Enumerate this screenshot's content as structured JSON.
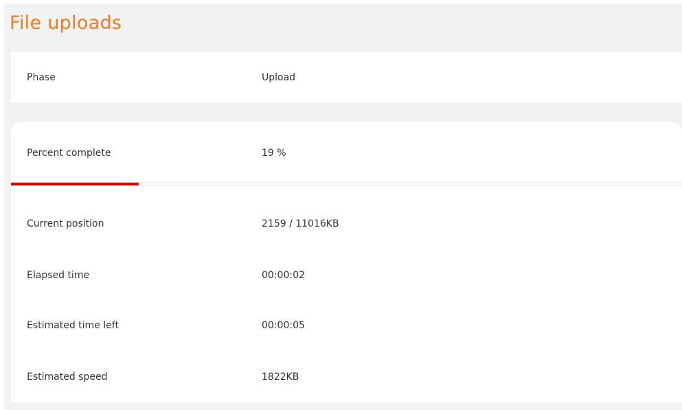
{
  "title": "File uploads",
  "phase": {
    "label": "Phase",
    "value": "Upload"
  },
  "progress": {
    "label": "Percent complete",
    "value": "19 %",
    "percent": 19,
    "bar_color": "#dd0000"
  },
  "details": [
    {
      "label": "Current position",
      "value": "2159 / 11016KB"
    },
    {
      "label": "Elapsed time",
      "value": "00:00:02"
    },
    {
      "label": "Estimated time left",
      "value": "00:00:05"
    },
    {
      "label": "Estimated speed",
      "value": "1822KB"
    }
  ],
  "colors": {
    "title": "#ee7d1c",
    "panel_background": "#f2f2f2",
    "card_background": "#ffffff",
    "text": "#333333"
  }
}
